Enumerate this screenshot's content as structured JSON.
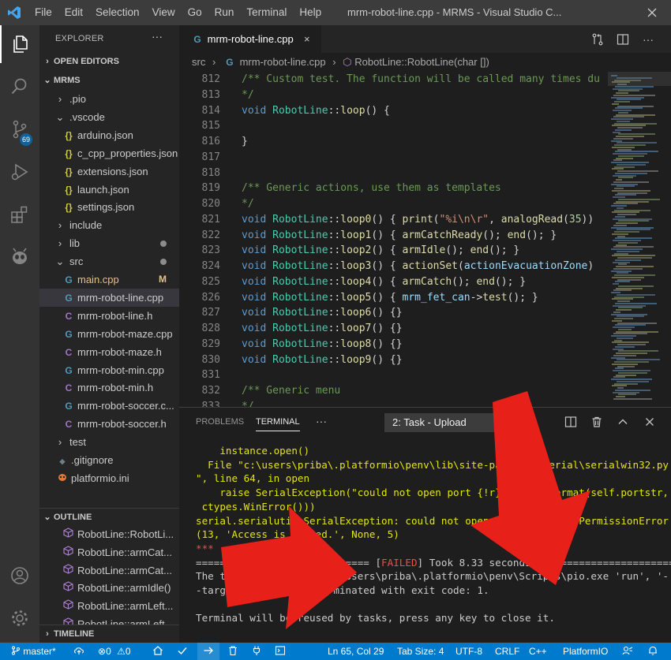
{
  "titlebar": {
    "menu": [
      "File",
      "Edit",
      "Selection",
      "View",
      "Go",
      "Run",
      "Terminal",
      "Help"
    ],
    "title": "mrm-robot-line.cpp - MRMS - Visual Studio C..."
  },
  "activity": {
    "scm_badge": "69"
  },
  "sidebar": {
    "title": "EXPLORER",
    "dots": "···",
    "open_editors": "OPEN EDITORS",
    "workspace": "MRMS",
    "tree": [
      {
        "label": ".pio",
        "type": "folder",
        "open": false,
        "indent": 1
      },
      {
        "label": ".vscode",
        "type": "folder",
        "open": true,
        "indent": 1
      },
      {
        "label": "arduino.json",
        "type": "json",
        "indent": 2
      },
      {
        "label": "c_cpp_properties.json",
        "type": "json",
        "indent": 2
      },
      {
        "label": "extensions.json",
        "type": "json",
        "indent": 2
      },
      {
        "label": "launch.json",
        "type": "json",
        "indent": 2
      },
      {
        "label": "settings.json",
        "type": "json",
        "indent": 2
      },
      {
        "label": "include",
        "type": "folder",
        "open": false,
        "indent": 1
      },
      {
        "label": "lib",
        "type": "folder",
        "open": false,
        "indent": 1,
        "dot": true
      },
      {
        "label": "src",
        "type": "folder",
        "open": true,
        "indent": 1,
        "dot": true
      },
      {
        "label": "main.cpp",
        "type": "cpp",
        "indent": 2,
        "badge": "M"
      },
      {
        "label": "mrm-robot-line.cpp",
        "type": "cpp",
        "indent": 2,
        "selected": true
      },
      {
        "label": "mrm-robot-line.h",
        "type": "h",
        "indent": 2
      },
      {
        "label": "mrm-robot-maze.cpp",
        "type": "cpp",
        "indent": 2
      },
      {
        "label": "mrm-robot-maze.h",
        "type": "h",
        "indent": 2
      },
      {
        "label": "mrm-robot-min.cpp",
        "type": "cpp",
        "indent": 2
      },
      {
        "label": "mrm-robot-min.h",
        "type": "h",
        "indent": 2
      },
      {
        "label": "mrm-robot-soccer.c...",
        "type": "cpp",
        "indent": 2
      },
      {
        "label": "mrm-robot-soccer.h",
        "type": "h",
        "indent": 2
      },
      {
        "label": "test",
        "type": "folder",
        "open": false,
        "indent": 1
      },
      {
        "label": ".gitignore",
        "type": "git",
        "indent": 1
      },
      {
        "label": "platformio.ini",
        "type": "pio",
        "indent": 1
      }
    ],
    "outline": "OUTLINE",
    "outline_items": [
      "RobotLine::RobotLi...",
      "RobotLine::armCat...",
      "RobotLine::armCat...",
      "RobotLine::armIdle()",
      "RobotLine::armLeft...",
      "RobotLine::armLeft..."
    ],
    "timeline": "TIMELINE"
  },
  "editor": {
    "tab_label": "mrm-robot-line.cpp",
    "tab_close": "×",
    "breadcrumb": {
      "folder": "src",
      "file": "mrm-robot-line.cpp",
      "symbol": "RobotLine::RobotLine(char [])"
    },
    "lines": [
      {
        "n": "812",
        "t": [
          [
            "c-com",
            "/** Custom test. The function will be called many times du"
          ]
        ]
      },
      {
        "n": "813",
        "t": [
          [
            "c-com",
            "*/"
          ]
        ]
      },
      {
        "n": "814",
        "t": [
          [
            "c-kw",
            "void "
          ],
          [
            "c-cls",
            "RobotLine"
          ],
          [
            "c-p",
            "::"
          ],
          [
            "c-fn",
            "loop"
          ],
          [
            "c-p",
            "() {"
          ]
        ]
      },
      {
        "n": "815",
        "t": []
      },
      {
        "n": "816",
        "t": [
          [
            "c-p",
            "}"
          ]
        ]
      },
      {
        "n": "817",
        "t": []
      },
      {
        "n": "818",
        "t": []
      },
      {
        "n": "819",
        "t": [
          [
            "c-com",
            "/** Generic actions, use them as templates"
          ]
        ]
      },
      {
        "n": "820",
        "t": [
          [
            "c-com",
            "*/"
          ]
        ]
      },
      {
        "n": "821",
        "t": [
          [
            "c-kw",
            "void "
          ],
          [
            "c-cls",
            "RobotLine"
          ],
          [
            "c-p",
            "::"
          ],
          [
            "c-fn",
            "loop0"
          ],
          [
            "c-p",
            "() { "
          ],
          [
            "c-fn",
            "print"
          ],
          [
            "c-p",
            "("
          ],
          [
            "c-str",
            "\"%i\\n\\r\""
          ],
          [
            "c-p",
            ", "
          ],
          [
            "c-fn",
            "analogRead"
          ],
          [
            "c-p",
            "("
          ],
          [
            "c-num",
            "35"
          ],
          [
            "c-p",
            "))"
          ]
        ]
      },
      {
        "n": "822",
        "t": [
          [
            "c-kw",
            "void "
          ],
          [
            "c-cls",
            "RobotLine"
          ],
          [
            "c-p",
            "::"
          ],
          [
            "c-fn",
            "loop1"
          ],
          [
            "c-p",
            "() { "
          ],
          [
            "c-fn",
            "armCatchReady"
          ],
          [
            "c-p",
            "(); "
          ],
          [
            "c-fn",
            "end"
          ],
          [
            "c-p",
            "(); }"
          ]
        ]
      },
      {
        "n": "823",
        "t": [
          [
            "c-kw",
            "void "
          ],
          [
            "c-cls",
            "RobotLine"
          ],
          [
            "c-p",
            "::"
          ],
          [
            "c-fn",
            "loop2"
          ],
          [
            "c-p",
            "() { "
          ],
          [
            "c-fn",
            "armIdle"
          ],
          [
            "c-p",
            "(); "
          ],
          [
            "c-fn",
            "end"
          ],
          [
            "c-p",
            "(); }"
          ]
        ]
      },
      {
        "n": "824",
        "t": [
          [
            "c-kw",
            "void "
          ],
          [
            "c-cls",
            "RobotLine"
          ],
          [
            "c-p",
            "::"
          ],
          [
            "c-fn",
            "loop3"
          ],
          [
            "c-p",
            "() { "
          ],
          [
            "c-fn",
            "actionSet"
          ],
          [
            "c-p",
            "("
          ],
          [
            "c-var",
            "actionEvacuationZone"
          ],
          [
            "c-p",
            ")"
          ]
        ]
      },
      {
        "n": "825",
        "t": [
          [
            "c-kw",
            "void "
          ],
          [
            "c-cls",
            "RobotLine"
          ],
          [
            "c-p",
            "::"
          ],
          [
            "c-fn",
            "loop4"
          ],
          [
            "c-p",
            "() { "
          ],
          [
            "c-fn",
            "armCatch"
          ],
          [
            "c-p",
            "(); "
          ],
          [
            "c-fn",
            "end"
          ],
          [
            "c-p",
            "(); }"
          ]
        ]
      },
      {
        "n": "826",
        "t": [
          [
            "c-kw",
            "void "
          ],
          [
            "c-cls",
            "RobotLine"
          ],
          [
            "c-p",
            "::"
          ],
          [
            "c-fn",
            "loop5"
          ],
          [
            "c-p",
            "() { "
          ],
          [
            "c-var",
            "mrm_fet_can"
          ],
          [
            "c-p",
            "->"
          ],
          [
            "c-fn",
            "test"
          ],
          [
            "c-p",
            "(); }"
          ]
        ]
      },
      {
        "n": "827",
        "t": [
          [
            "c-kw",
            "void "
          ],
          [
            "c-cls",
            "RobotLine"
          ],
          [
            "c-p",
            "::"
          ],
          [
            "c-fn",
            "loop6"
          ],
          [
            "c-p",
            "() {}"
          ]
        ]
      },
      {
        "n": "828",
        "t": [
          [
            "c-kw",
            "void "
          ],
          [
            "c-cls",
            "RobotLine"
          ],
          [
            "c-p",
            "::"
          ],
          [
            "c-fn",
            "loop7"
          ],
          [
            "c-p",
            "() {}"
          ]
        ]
      },
      {
        "n": "829",
        "t": [
          [
            "c-kw",
            "void "
          ],
          [
            "c-cls",
            "RobotLine"
          ],
          [
            "c-p",
            "::"
          ],
          [
            "c-fn",
            "loop8"
          ],
          [
            "c-p",
            "() {}"
          ]
        ]
      },
      {
        "n": "830",
        "t": [
          [
            "c-kw",
            "void "
          ],
          [
            "c-cls",
            "RobotLine"
          ],
          [
            "c-p",
            "::"
          ],
          [
            "c-fn",
            "loop9"
          ],
          [
            "c-p",
            "() {}"
          ]
        ]
      },
      {
        "n": "831",
        "t": []
      },
      {
        "n": "832",
        "t": [
          [
            "c-com",
            "/** Generic menu"
          ]
        ]
      },
      {
        "n": "833",
        "t": [
          [
            "c-com",
            "*/"
          ]
        ]
      }
    ]
  },
  "panel": {
    "tabs": [
      "PROBLEMS",
      "TERMINAL"
    ],
    "more": "···",
    "task": "2: Task - Upload",
    "terminal": [
      {
        "c": "t-y",
        "t": "    instance.open()"
      },
      {
        "c": "t-y",
        "t": "  File \"c:\\users\\priba\\.platformio\\penv\\lib\\site-packages\\serial\\serialwin32.py"
      },
      {
        "c": "t-y",
        "t": "\", line 64, in open"
      },
      {
        "c": "t-y",
        "t": "    raise SerialException(\"could not open port {!r}: {!r}\".format(self.portstr,"
      },
      {
        "c": "t-y",
        "t": " ctypes.WinError()))"
      },
      {
        "c": "t-y",
        "t": "serial.serialutil.SerialException: could not open port 'COM17': PermissionError"
      },
      {
        "c": "t-y",
        "t": "(13, 'Access is denied.', None, 5)"
      },
      {
        "c": "t-r",
        "t": "***"
      },
      {
        "c": "mixed",
        "parts": [
          [
            "t-w",
            "============================= ["
          ],
          [
            "t-r",
            "FAILED"
          ],
          [
            "t-w",
            "] Took 8.33 seconds ========================"
          ]
        ]
      },
      {
        "c": "t-w",
        "t": "The terminal process \"C:\\Users\\priba\\.platformio\\penv\\Scripts\\pio.exe 'run', '-"
      },
      {
        "c": "t-w",
        "t": "-target', 'upload'\" terminated with exit code: 1."
      },
      {
        "c": "t-w",
        "t": ""
      },
      {
        "c": "t-w",
        "t": "Terminal will be reused by tasks, press any key to close it."
      }
    ]
  },
  "statusbar": {
    "branch": "master*",
    "errors": "0",
    "warnings": "0",
    "position": "Ln 65, Col 29",
    "tabsize": "Tab Size: 4",
    "encoding": "UTF-8",
    "eol": "CRLF",
    "language": "C++",
    "platform": "PlatformIO"
  },
  "colors": {
    "accent": "#007acc",
    "arrow": "#e8201a"
  }
}
